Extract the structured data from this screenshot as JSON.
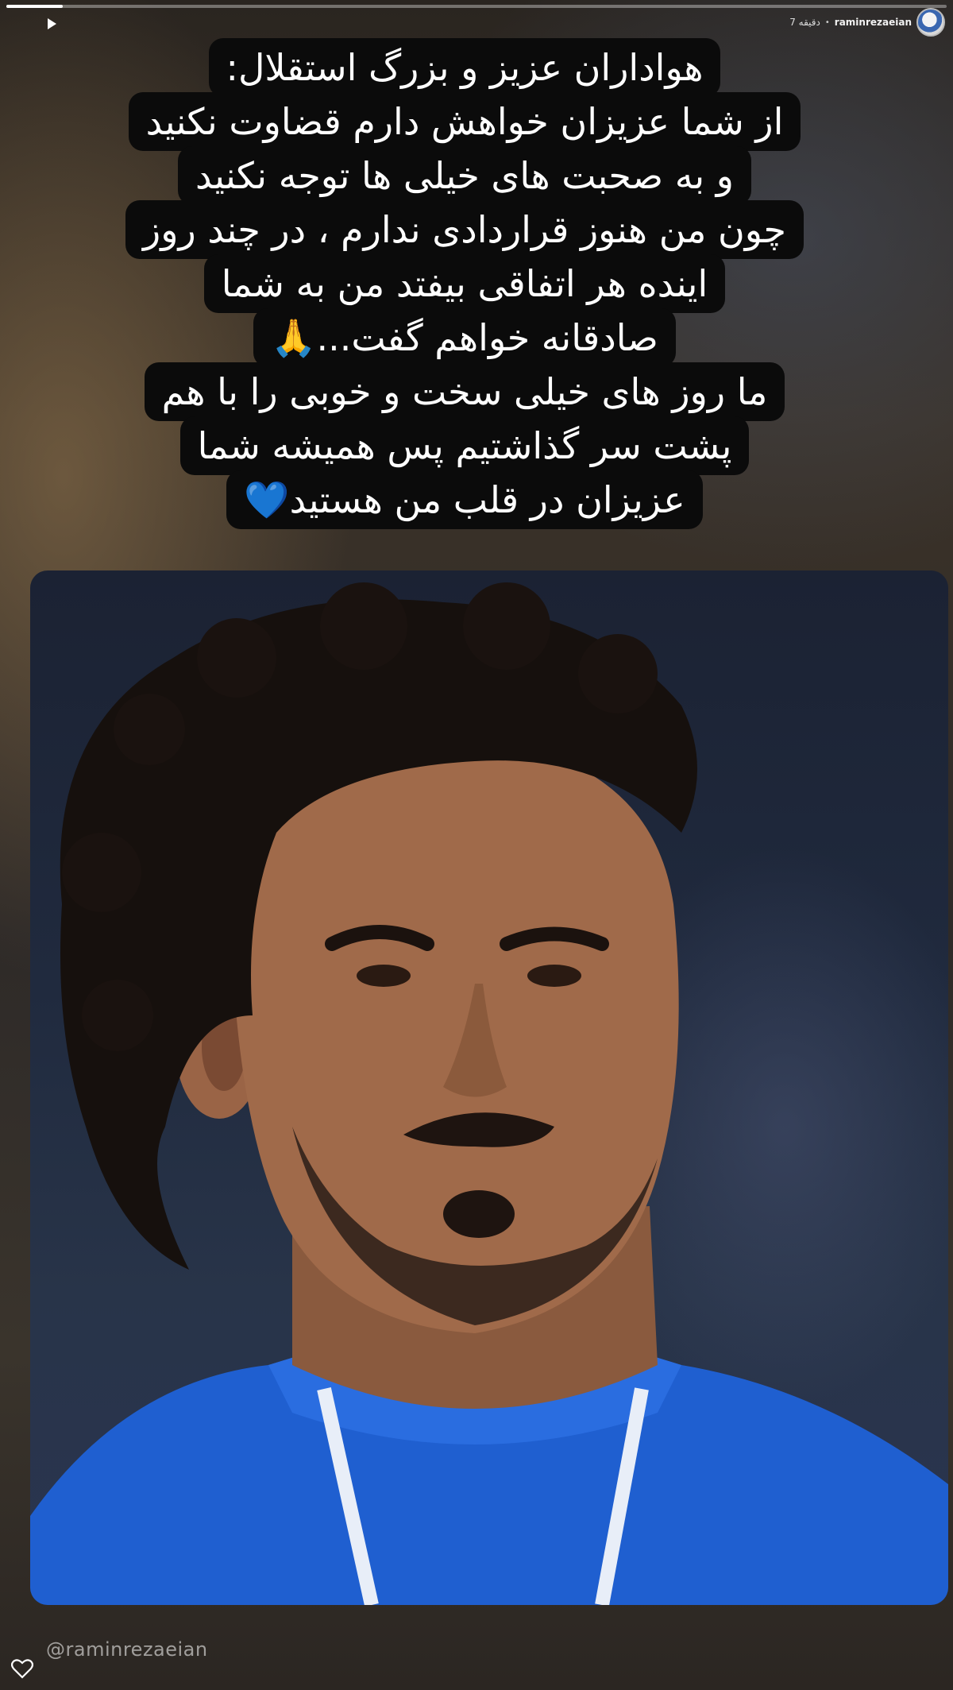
{
  "story": {
    "progress": 0.06,
    "time_label": "7 دقیقه",
    "username": "raminrezaeian",
    "message_lines": [
      "هواداران عزیز و بزرگ استقلال:",
      "از شما عزیزان خواهش دارم  قضاوت نکنید",
      "و به صحبت های خیلی ها توجه نکنید",
      "چون من هنوز قراردادی ندارم ، در چند روز",
      "اینده هر اتفاقی بیفتد من به شما",
      "صادقانه خواهم گفت...🙏",
      "ما روز های خیلی سخت و خوبی را با هم",
      "پشت سر گذاشتیم پس همیشه شما",
      "عزیزان در قلب من هستید💙"
    ],
    "mention": "@raminrezaeian"
  },
  "icons": {
    "play": "play-icon",
    "heart": "heart-icon",
    "avatar": "avatar"
  },
  "colors": {
    "text_bg": "#0b0b0b",
    "text": "#ffffff",
    "jersey": "#1f5fd0"
  }
}
